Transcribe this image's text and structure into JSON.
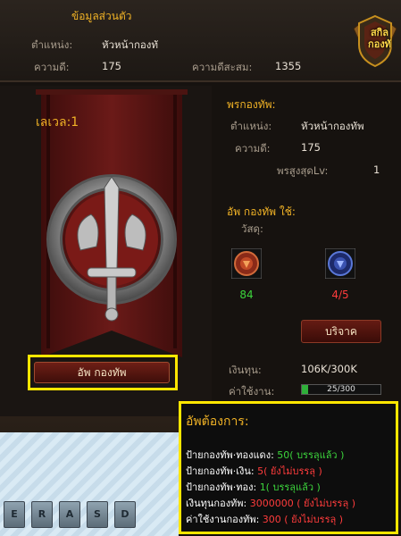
{
  "personal": {
    "title": "ข้อมูลส่วนตัว",
    "position_label": "ตำแหน่ง:",
    "position_value": "หัวหน้ากองทั",
    "merit_label": "ความดี:",
    "merit_value": "175",
    "accum_label": "ความดีสะสม:",
    "accum_value": "1355"
  },
  "skill_badge": {
    "line1": "สกิล",
    "line2": "กองทั"
  },
  "level": {
    "label": "เลเวล:1"
  },
  "upgrade_button": {
    "label": "อัพ กองทัพ"
  },
  "guild": {
    "title": "พรกองทัพ:",
    "position_label": "ตำแหน่ง:",
    "position_value": "หัวหน้ากองทัพ",
    "merit_label": "ความดี:",
    "merit_value": "175",
    "max_label": "พรสูงสุดLv:",
    "max_value": "1",
    "upgrade_use_label": "อัพ กองทัพ ใช้:",
    "material_label": "วัสดุ:",
    "material1_count": "84",
    "material2_count": "4/5",
    "donate_label": "บริจาค",
    "funds_label": "เงินทุน:",
    "funds_value": "106K/300K",
    "cost_label": "ค่าใช้งาน:",
    "cost_progress_text": "25/300",
    "cost_progress": 0.08333
  },
  "keys": [
    "E",
    "R",
    "A",
    "S",
    "D"
  ],
  "tooltip": {
    "title": "อัพต้องการ:",
    "rows": [
      {
        "label": "ป้ายกองทัพ·ทองแดง:",
        "value": "50( บรรลุแล้ว )",
        "status": "ok"
      },
      {
        "label": "ป้ายกองทัพ·เงิน:",
        "value": "5( ยังไม่บรรลุ )",
        "status": "no"
      },
      {
        "label": "ป้ายกองทัพ·ทอง:",
        "value": "1( บรรลุแล้ว )",
        "status": "ok"
      },
      {
        "label": "เงินทุนกองทัพ:",
        "value": "3000000 ( ยังไม่บรรลุ )",
        "status": "no"
      },
      {
        "label": "ค่าใช้งานกองทัพ:",
        "value": "300 ( ยังไม่บรรลุ )",
        "status": "no"
      }
    ]
  },
  "colors": {
    "gold": "#f0b226",
    "ok_green": "#3cd43c",
    "fail_red": "#ff3c3c",
    "highlight_yellow": "#ffe600"
  },
  "icons": {
    "skill_badge": "shield-wings-icon",
    "emblem": "sword-ring-emblem",
    "material1": "red-token-icon",
    "material2": "blue-token-icon"
  }
}
